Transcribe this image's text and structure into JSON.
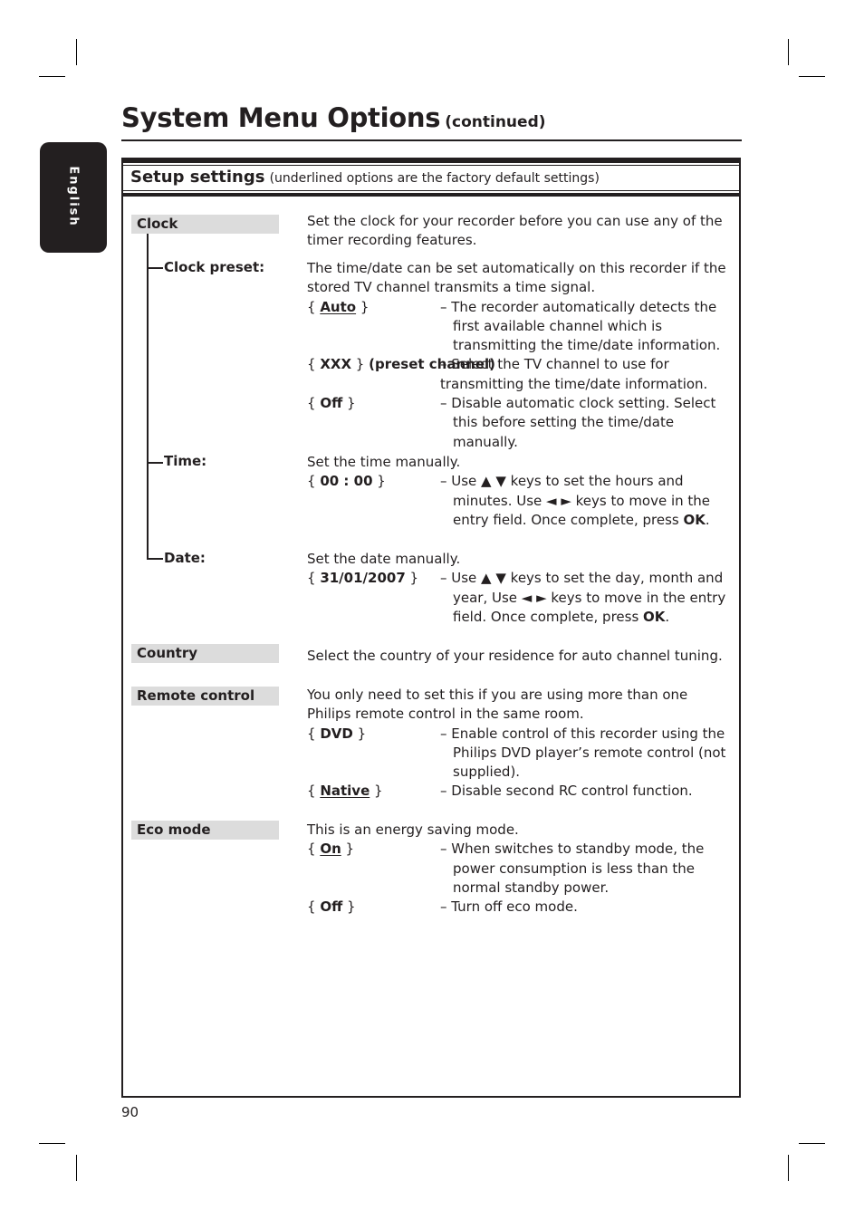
{
  "page": {
    "title": "System Menu Options",
    "title_suffix": "(continued)",
    "language_tab": "English",
    "page_number": "90"
  },
  "section": {
    "heading": "Setup settings",
    "note": "(underlined options are the factory default settings)"
  },
  "settings": {
    "clock": {
      "label": "Clock",
      "description": "Set the clock for your recorder before you can use any of the timer recording features.",
      "clock_preset": {
        "label": "Clock preset:",
        "description": "The time/date can be set automatically on this recorder if the stored TV channel transmits a time signal.",
        "options": [
          {
            "key": "Auto",
            "default": true,
            "text": "– The recorder automatically detects the first available channel which is transmitting the time/date information."
          },
          {
            "key": "XXX",
            "suffix": "(preset channel)",
            "default": false,
            "text": "–  Select the TV channel to use for transmitting the time/date information."
          },
          {
            "key": "Off",
            "default": false,
            "text": "– Disable automatic clock setting.  Select this before setting the time/date manually."
          }
        ]
      },
      "time": {
        "label": "Time:",
        "description": "Set the time manually.",
        "option": {
          "key": "00 : 00",
          "text_before_ok": "– Use ▲ ▼ keys to set the hours and minutes. Use ◄ ► keys to move in the entry field. Once complete, press ",
          "ok": "OK",
          "text_after": "."
        }
      },
      "date": {
        "label": "Date:",
        "description": "Set the date manually.",
        "option": {
          "key": "31/01/2007",
          "text_before_ok": "– Use ▲ ▼ keys to set the day, month and year, Use ◄ ► keys to move in the entry field. Once complete, press ",
          "ok": "OK",
          "text_after": "."
        }
      }
    },
    "country": {
      "label": "Country",
      "description": "Select the country of your residence for auto channel tuning."
    },
    "remote_control": {
      "label": "Remote control",
      "description": "You only need to set this if you are using more than one Philips remote control in the same room.",
      "options": [
        {
          "key": "DVD",
          "default": false,
          "text": "– Enable control of this recorder using the Philips DVD player’s remote control (not supplied)."
        },
        {
          "key": "Native",
          "default": true,
          "text": "– Disable second RC control function."
        }
      ]
    },
    "eco_mode": {
      "label": "Eco mode",
      "description": "This is an energy saving mode.",
      "options": [
        {
          "key": "On",
          "default": true,
          "text": "– When switches to standby mode, the power consumption is less than the normal standby power."
        },
        {
          "key": "Off",
          "default": false,
          "text": "– Turn off eco mode."
        }
      ]
    }
  },
  "symbols": {
    "open_brace": "{ ",
    "close_brace": " }"
  }
}
